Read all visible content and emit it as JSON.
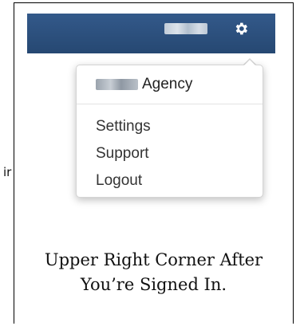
{
  "header": {
    "username": "",
    "settings_icon": "gear-icon",
    "bar_color": "#2c4f7d"
  },
  "stray_text": "ir",
  "dropdown": {
    "account_name_suffix": "Agency",
    "items": [
      {
        "label": "Settings"
      },
      {
        "label": "Support"
      },
      {
        "label": "Logout"
      }
    ]
  },
  "caption": {
    "line1": "Upper Right Corner After",
    "line2": "You’re Signed In."
  }
}
